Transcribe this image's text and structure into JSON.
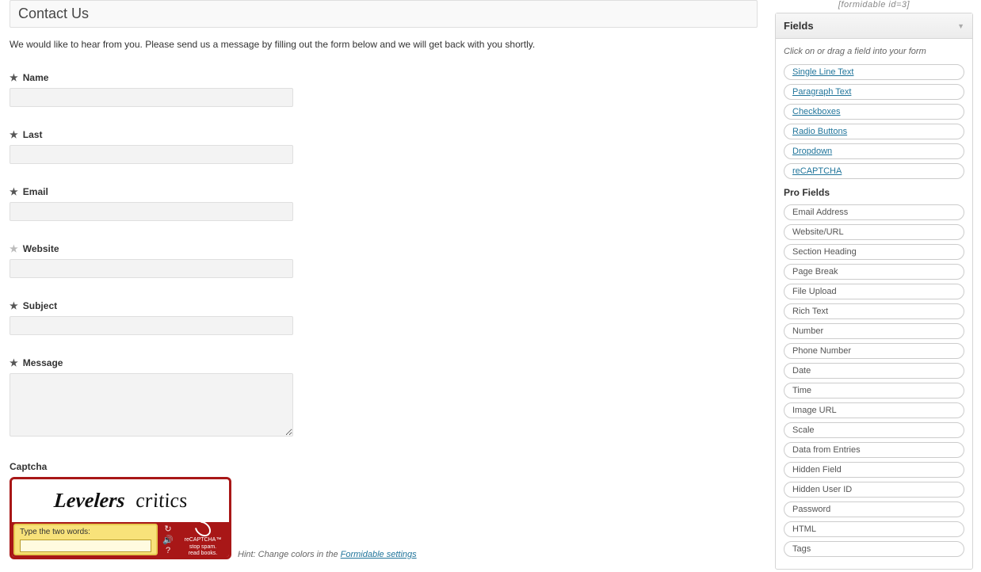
{
  "header": {
    "shortcode": "[formidable id=3]",
    "title": "Contact Us"
  },
  "intro": "We would like to hear from you. Please send us a message by filling out the form below and we will get back with you shortly.",
  "fields": {
    "name_label": "Name",
    "last_label": "Last",
    "email_label": "Email",
    "website_label": "Website",
    "subject_label": "Subject",
    "message_label": "Message",
    "captcha_label": "Captcha",
    "required_glyph": "★",
    "optional_glyph": "★"
  },
  "recaptcha": {
    "word1": "Levelers",
    "word2": "critics",
    "prompt": "Type the two words:",
    "brand": "reCAPTCHA™",
    "tagline1": "stop spam.",
    "tagline2": "read books."
  },
  "hint": {
    "prefix": "Hint: Change colors in the ",
    "link": "Formidable settings"
  },
  "sidebar": {
    "panel_title": "Fields",
    "panel_hint": "Click on or drag a field into your form",
    "basic_fields": [
      "Single Line Text",
      "Paragraph Text",
      "Checkboxes",
      "Radio Buttons",
      "Dropdown",
      "reCAPTCHA"
    ],
    "pro_title": "Pro Fields",
    "pro_fields": [
      "Email Address",
      "Website/URL",
      "Section Heading",
      "Page Break",
      "File Upload",
      "Rich Text",
      "Number",
      "Phone Number",
      "Date",
      "Time",
      "Image URL",
      "Scale",
      "Data from Entries",
      "Hidden Field",
      "Hidden User ID",
      "Password",
      "HTML",
      "Tags"
    ]
  }
}
